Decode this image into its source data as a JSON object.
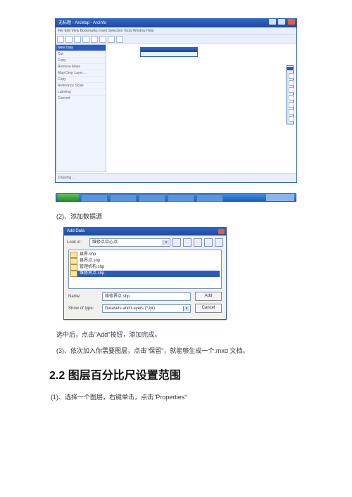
{
  "arcmap": {
    "title": "无标题 - ArcMap - ArcInfo",
    "menu": "File  Edit  View  Bookmarks  Insert  Selection  Tools  Window  Help",
    "status": "Drawing …",
    "toc_highlight": "New Data",
    "toc_rows": [
      "Cut",
      "Copy",
      "Remove Make",
      "Map Drop Layer…",
      "Copy",
      "Reference Scale",
      "Labeling",
      "Convert"
    ]
  },
  "step2": "(2)、添加数据源",
  "adddata": {
    "title": "Add Data",
    "lookLabel": "Look in:",
    "lookValue": "维修点中心点",
    "items": [
      "县界.shp",
      "县界点.shp",
      "管理机构.shp",
      "维修界点.shp"
    ],
    "nameLabel": "Name:",
    "nameValue": "维修界点.shp",
    "typeLabel": "Show of type:",
    "typeValue": "Datasets and Layers (*.lyr)",
    "addBtn": "Add",
    "cancelBtn": "Cancel"
  },
  "after_add": "选中后，点击\"Add\"按钮，添加完成。",
  "step3": "(3)、依次加入你需要图层，点击\"保留\"，就能够生成一个.mxd 文档。",
  "section": "2.2  图层百分比尺设置范围",
  "step_21_1": "(1)、选择一个图层，右键单击，点击\"Properties\""
}
